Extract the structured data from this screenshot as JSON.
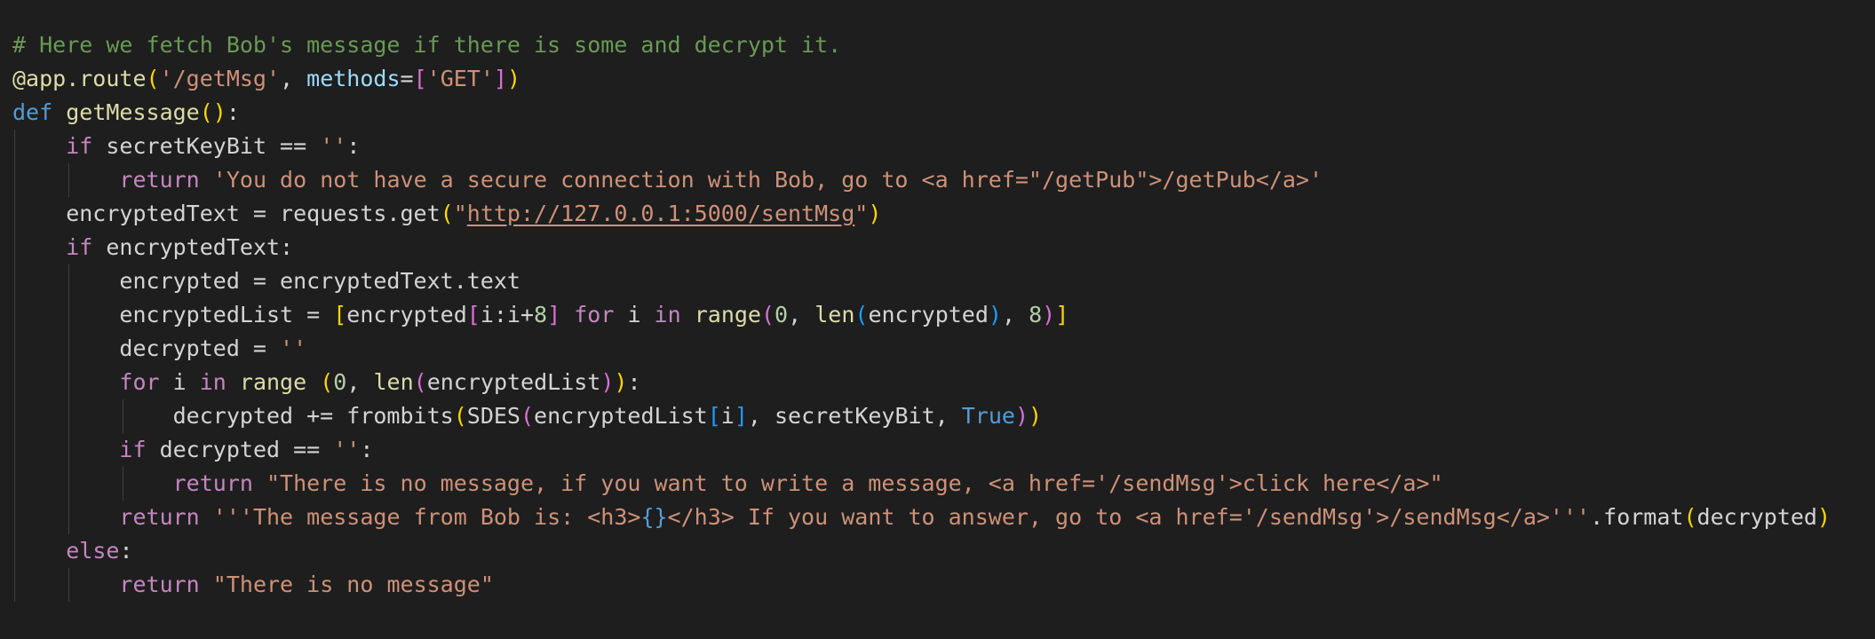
{
  "editor": {
    "lines": [
      {
        "indent": 0,
        "tokens": [
          {
            "t": "# Here we fetch Bob's message if there is some and decrypt it.",
            "c": "comment"
          }
        ]
      },
      {
        "indent": 0,
        "tokens": [
          {
            "t": "@app.route",
            "c": "fn"
          },
          {
            "t": "(",
            "c": "b1"
          },
          {
            "t": "'/getMsg'",
            "c": "str"
          },
          {
            "t": ", ",
            "c": "plain"
          },
          {
            "t": "methods",
            "c": "var"
          },
          {
            "t": "=",
            "c": "plain"
          },
          {
            "t": "[",
            "c": "b2"
          },
          {
            "t": "'GET'",
            "c": "str"
          },
          {
            "t": "]",
            "c": "b2"
          },
          {
            "t": ")",
            "c": "b1"
          }
        ]
      },
      {
        "indent": 0,
        "tokens": [
          {
            "t": "def",
            "c": "kw"
          },
          {
            "t": " ",
            "c": "plain"
          },
          {
            "t": "getMessage",
            "c": "fn"
          },
          {
            "t": "()",
            "c": "b1"
          },
          {
            "t": ":",
            "c": "plain"
          }
        ]
      },
      {
        "indent": 1,
        "tokens": [
          {
            "t": "    ",
            "c": "plain"
          },
          {
            "t": "if",
            "c": "ctrl"
          },
          {
            "t": " secretKeyBit == ",
            "c": "plain"
          },
          {
            "t": "''",
            "c": "str"
          },
          {
            "t": ":",
            "c": "plain"
          }
        ]
      },
      {
        "indent": 2,
        "tokens": [
          {
            "t": "        ",
            "c": "plain"
          },
          {
            "t": "return",
            "c": "ctrl"
          },
          {
            "t": " ",
            "c": "plain"
          },
          {
            "t": "'You do not have a secure connection with Bob, go to <a href=\"/getPub\">/getPub</a>'",
            "c": "str"
          }
        ]
      },
      {
        "indent": 1,
        "tokens": [
          {
            "t": "    encryptedText = requests.get",
            "c": "plain"
          },
          {
            "t": "(",
            "c": "b1"
          },
          {
            "t": "\"",
            "c": "str"
          },
          {
            "t": "http://127.0.0.1:5000/sentMsg",
            "c": "str",
            "link": true
          },
          {
            "t": "\"",
            "c": "str"
          },
          {
            "t": ")",
            "c": "b1"
          }
        ]
      },
      {
        "indent": 1,
        "tokens": [
          {
            "t": "    ",
            "c": "plain"
          },
          {
            "t": "if",
            "c": "ctrl"
          },
          {
            "t": " encryptedText:",
            "c": "plain"
          }
        ]
      },
      {
        "indent": 2,
        "tokens": [
          {
            "t": "        encrypted = encryptedText.text",
            "c": "plain"
          }
        ]
      },
      {
        "indent": 2,
        "tokens": [
          {
            "t": "        encryptedList = ",
            "c": "plain"
          },
          {
            "t": "[",
            "c": "b1"
          },
          {
            "t": "encrypted",
            "c": "plain"
          },
          {
            "t": "[",
            "c": "b2"
          },
          {
            "t": "i:i+",
            "c": "plain"
          },
          {
            "t": "8",
            "c": "num"
          },
          {
            "t": "]",
            "c": "b2"
          },
          {
            "t": " ",
            "c": "plain"
          },
          {
            "t": "for",
            "c": "ctrl"
          },
          {
            "t": " i ",
            "c": "plain"
          },
          {
            "t": "in",
            "c": "ctrl"
          },
          {
            "t": " ",
            "c": "plain"
          },
          {
            "t": "range",
            "c": "fn"
          },
          {
            "t": "(",
            "c": "b2"
          },
          {
            "t": "0",
            "c": "num"
          },
          {
            "t": ", ",
            "c": "plain"
          },
          {
            "t": "len",
            "c": "fn"
          },
          {
            "t": "(",
            "c": "b3"
          },
          {
            "t": "encrypted",
            "c": "plain"
          },
          {
            "t": ")",
            "c": "b3"
          },
          {
            "t": ", ",
            "c": "plain"
          },
          {
            "t": "8",
            "c": "num"
          },
          {
            "t": ")",
            "c": "b2"
          },
          {
            "t": "]",
            "c": "b1"
          }
        ]
      },
      {
        "indent": 2,
        "tokens": [
          {
            "t": "        decrypted = ",
            "c": "plain"
          },
          {
            "t": "''",
            "c": "str"
          }
        ]
      },
      {
        "indent": 2,
        "tokens": [
          {
            "t": "        ",
            "c": "plain"
          },
          {
            "t": "for",
            "c": "ctrl"
          },
          {
            "t": " i ",
            "c": "plain"
          },
          {
            "t": "in",
            "c": "ctrl"
          },
          {
            "t": " ",
            "c": "plain"
          },
          {
            "t": "range",
            "c": "fn"
          },
          {
            "t": " ",
            "c": "plain"
          },
          {
            "t": "(",
            "c": "b1"
          },
          {
            "t": "0",
            "c": "num"
          },
          {
            "t": ", ",
            "c": "plain"
          },
          {
            "t": "len",
            "c": "fn"
          },
          {
            "t": "(",
            "c": "b2"
          },
          {
            "t": "encryptedList",
            "c": "plain"
          },
          {
            "t": ")",
            "c": "b2"
          },
          {
            "t": ")",
            "c": "b1"
          },
          {
            "t": ":",
            "c": "plain"
          }
        ]
      },
      {
        "indent": 3,
        "tokens": [
          {
            "t": "            decrypted += frombits",
            "c": "plain"
          },
          {
            "t": "(",
            "c": "b1"
          },
          {
            "t": "SDES",
            "c": "plain"
          },
          {
            "t": "(",
            "c": "b2"
          },
          {
            "t": "encryptedList",
            "c": "plain"
          },
          {
            "t": "[",
            "c": "b3"
          },
          {
            "t": "i",
            "c": "plain"
          },
          {
            "t": "]",
            "c": "b3"
          },
          {
            "t": ", secretKeyBit, ",
            "c": "plain"
          },
          {
            "t": "True",
            "c": "kw"
          },
          {
            "t": ")",
            "c": "b2"
          },
          {
            "t": ")",
            "c": "b1"
          }
        ]
      },
      {
        "indent": 2,
        "tokens": [
          {
            "t": "        ",
            "c": "plain"
          },
          {
            "t": "if",
            "c": "ctrl"
          },
          {
            "t": " decrypted == ",
            "c": "plain"
          },
          {
            "t": "''",
            "c": "str"
          },
          {
            "t": ":",
            "c": "plain"
          }
        ]
      },
      {
        "indent": 3,
        "tokens": [
          {
            "t": "            ",
            "c": "plain"
          },
          {
            "t": "return",
            "c": "ctrl"
          },
          {
            "t": " ",
            "c": "plain"
          },
          {
            "t": "\"There is no message, if you want to write a message, <a href='/sendMsg'>click here</a>\"",
            "c": "str"
          }
        ]
      },
      {
        "indent": 2,
        "tokens": [
          {
            "t": "        ",
            "c": "plain"
          },
          {
            "t": "return",
            "c": "ctrl"
          },
          {
            "t": " ",
            "c": "plain"
          },
          {
            "t": "'''The message from Bob is: <h3>",
            "c": "str"
          },
          {
            "t": "{}",
            "c": "kw"
          },
          {
            "t": "</h3> If you want to answer, go to <a href='/sendMsg'>/sendMsg</a>'''",
            "c": "str"
          },
          {
            "t": ".format",
            "c": "plain"
          },
          {
            "t": "(",
            "c": "b1"
          },
          {
            "t": "decrypted",
            "c": "plain"
          },
          {
            "t": ")",
            "c": "b1"
          }
        ]
      },
      {
        "indent": 1,
        "tokens": [
          {
            "t": "    ",
            "c": "plain"
          },
          {
            "t": "else",
            "c": "ctrl"
          },
          {
            "t": ":",
            "c": "plain"
          }
        ]
      },
      {
        "indent": 2,
        "tokens": [
          {
            "t": "        ",
            "c": "plain"
          },
          {
            "t": "return",
            "c": "ctrl"
          },
          {
            "t": " ",
            "c": "plain"
          },
          {
            "t": "\"There is no message\"",
            "c": "str"
          }
        ]
      }
    ]
  }
}
